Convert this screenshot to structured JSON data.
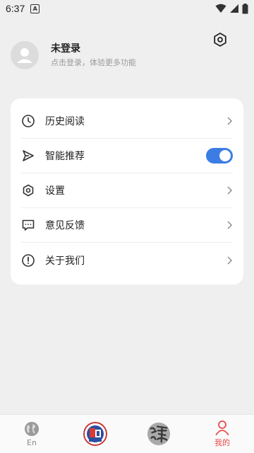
{
  "status_bar": {
    "time": "6:37",
    "notification_glyph": "A",
    "icons": [
      "wifi-icon",
      "signal-icon",
      "battery-icon"
    ]
  },
  "header": {
    "settings_icon": "gear-icon"
  },
  "profile": {
    "name": "未登录",
    "hint": "点击登录，体验更多功能",
    "avatar_icon": "user-icon"
  },
  "menu": {
    "items": [
      {
        "label": "历史阅读",
        "icon": "clock-icon",
        "control": "chevron"
      },
      {
        "label": "智能推荐",
        "icon": "send-icon",
        "control": "toggle",
        "toggle_on": true
      },
      {
        "label": "设置",
        "icon": "gear-icon",
        "control": "chevron"
      },
      {
        "label": "意见反馈",
        "icon": "message-icon",
        "control": "chevron"
      },
      {
        "label": "关于我们",
        "icon": "info-icon",
        "control": "chevron"
      }
    ]
  },
  "bottom_nav": {
    "items": [
      {
        "label": "En",
        "icon": "globe-icon",
        "active": false
      },
      {
        "label": "",
        "icon": "badge-logo-icon",
        "active": false
      },
      {
        "label": "",
        "icon": "calligraphy-logo-icon",
        "active": false
      },
      {
        "label": "我的",
        "icon": "person-icon",
        "active": true
      }
    ]
  },
  "colors": {
    "background": "#efefef",
    "card": "#ffffff",
    "accent": "#3b7de3",
    "active_tab": "#e84a4a"
  }
}
